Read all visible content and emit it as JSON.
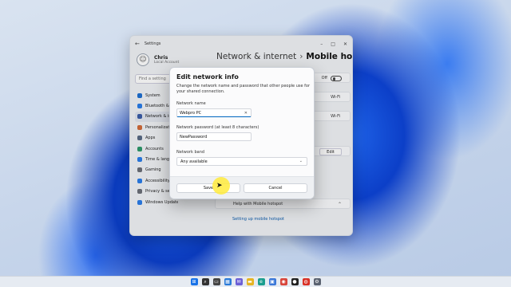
{
  "window": {
    "app_title": "Settings",
    "back_label": "←",
    "minimize": "–",
    "maximize": "□",
    "close": "✕"
  },
  "user": {
    "name": "Chris",
    "account": "Local Account",
    "avatar_glyph": "☺"
  },
  "search": {
    "placeholder": "Find a setting"
  },
  "sidebar": {
    "items": [
      {
        "label": "System",
        "icon": "system-icon",
        "color": "#1f6fd1"
      },
      {
        "label": "Bluetooth & devices",
        "icon": "bluetooth-icon",
        "color": "#2b7de9"
      },
      {
        "label": "Network & internet",
        "icon": "network-icon",
        "color": "#3a5da8",
        "active": true
      },
      {
        "label": "Personalization",
        "icon": "personalization-icon",
        "color": "#d26b3a"
      },
      {
        "label": "Apps",
        "icon": "apps-icon",
        "color": "#5a6b85"
      },
      {
        "label": "Accounts",
        "icon": "accounts-icon",
        "color": "#2e9a6b"
      },
      {
        "label": "Time & language",
        "icon": "time-icon",
        "color": "#2b7de9"
      },
      {
        "label": "Gaming",
        "icon": "gaming-icon",
        "color": "#6b6f78"
      },
      {
        "label": "Accessibility",
        "icon": "accessibility-icon",
        "color": "#2b7de9"
      },
      {
        "label": "Privacy & security",
        "icon": "shield-icon",
        "color": "#6b6f78"
      },
      {
        "label": "Windows Update",
        "icon": "update-icon",
        "color": "#2b7de9"
      }
    ]
  },
  "breadcrumb": {
    "parent": "Network & internet",
    "separator": "›",
    "current": "Mobile hotspot"
  },
  "background_rows": {
    "toggle_state": "Off",
    "wifi_1": "Wi-Fi",
    "wifi_2": "Wi-Fi",
    "edit_label": "Edit",
    "help_title": "Help with Mobile hotspot",
    "help_link": "Setting up mobile hotspot"
  },
  "dialog": {
    "title": "Edit network info",
    "description": "Change the network name and password that other people use for your shared connection.",
    "name_label": "Network name",
    "name_value": "Webpro PC",
    "clear_glyph": "✕",
    "password_label": "Network password (at least 8 characters)",
    "password_value": "NewPassword",
    "band_label": "Network band",
    "band_value": "Any available",
    "caret_glyph": "⌄",
    "save_label": "Save",
    "cancel_label": "Cancel"
  },
  "taskbar": {
    "icons": [
      {
        "name": "start-icon",
        "color": "#1a73e8",
        "glyph": "⊞"
      },
      {
        "name": "search-icon",
        "color": "#333333",
        "glyph": "⌕"
      },
      {
        "name": "task-view-icon",
        "color": "#444444",
        "glyph": "▭"
      },
      {
        "name": "widgets-icon",
        "color": "#2a7ad8",
        "glyph": "▦"
      },
      {
        "name": "chat-icon",
        "color": "#6c5fd6",
        "glyph": "✉"
      },
      {
        "name": "file-explorer-icon",
        "color": "#e6b422",
        "glyph": "▬"
      },
      {
        "name": "edge-icon",
        "color": "#1b9e8f",
        "glyph": "e"
      },
      {
        "name": "store-icon",
        "color": "#3b78d8",
        "glyph": "▣"
      },
      {
        "name": "browser-icon",
        "color": "#d8453b",
        "glyph": "◉"
      },
      {
        "name": "app-icon",
        "color": "#222222",
        "glyph": "●"
      },
      {
        "name": "chrome-icon",
        "color": "#d93025",
        "glyph": "◍"
      },
      {
        "name": "settings-icon",
        "color": "#5a6270",
        "glyph": "⚙"
      }
    ]
  }
}
